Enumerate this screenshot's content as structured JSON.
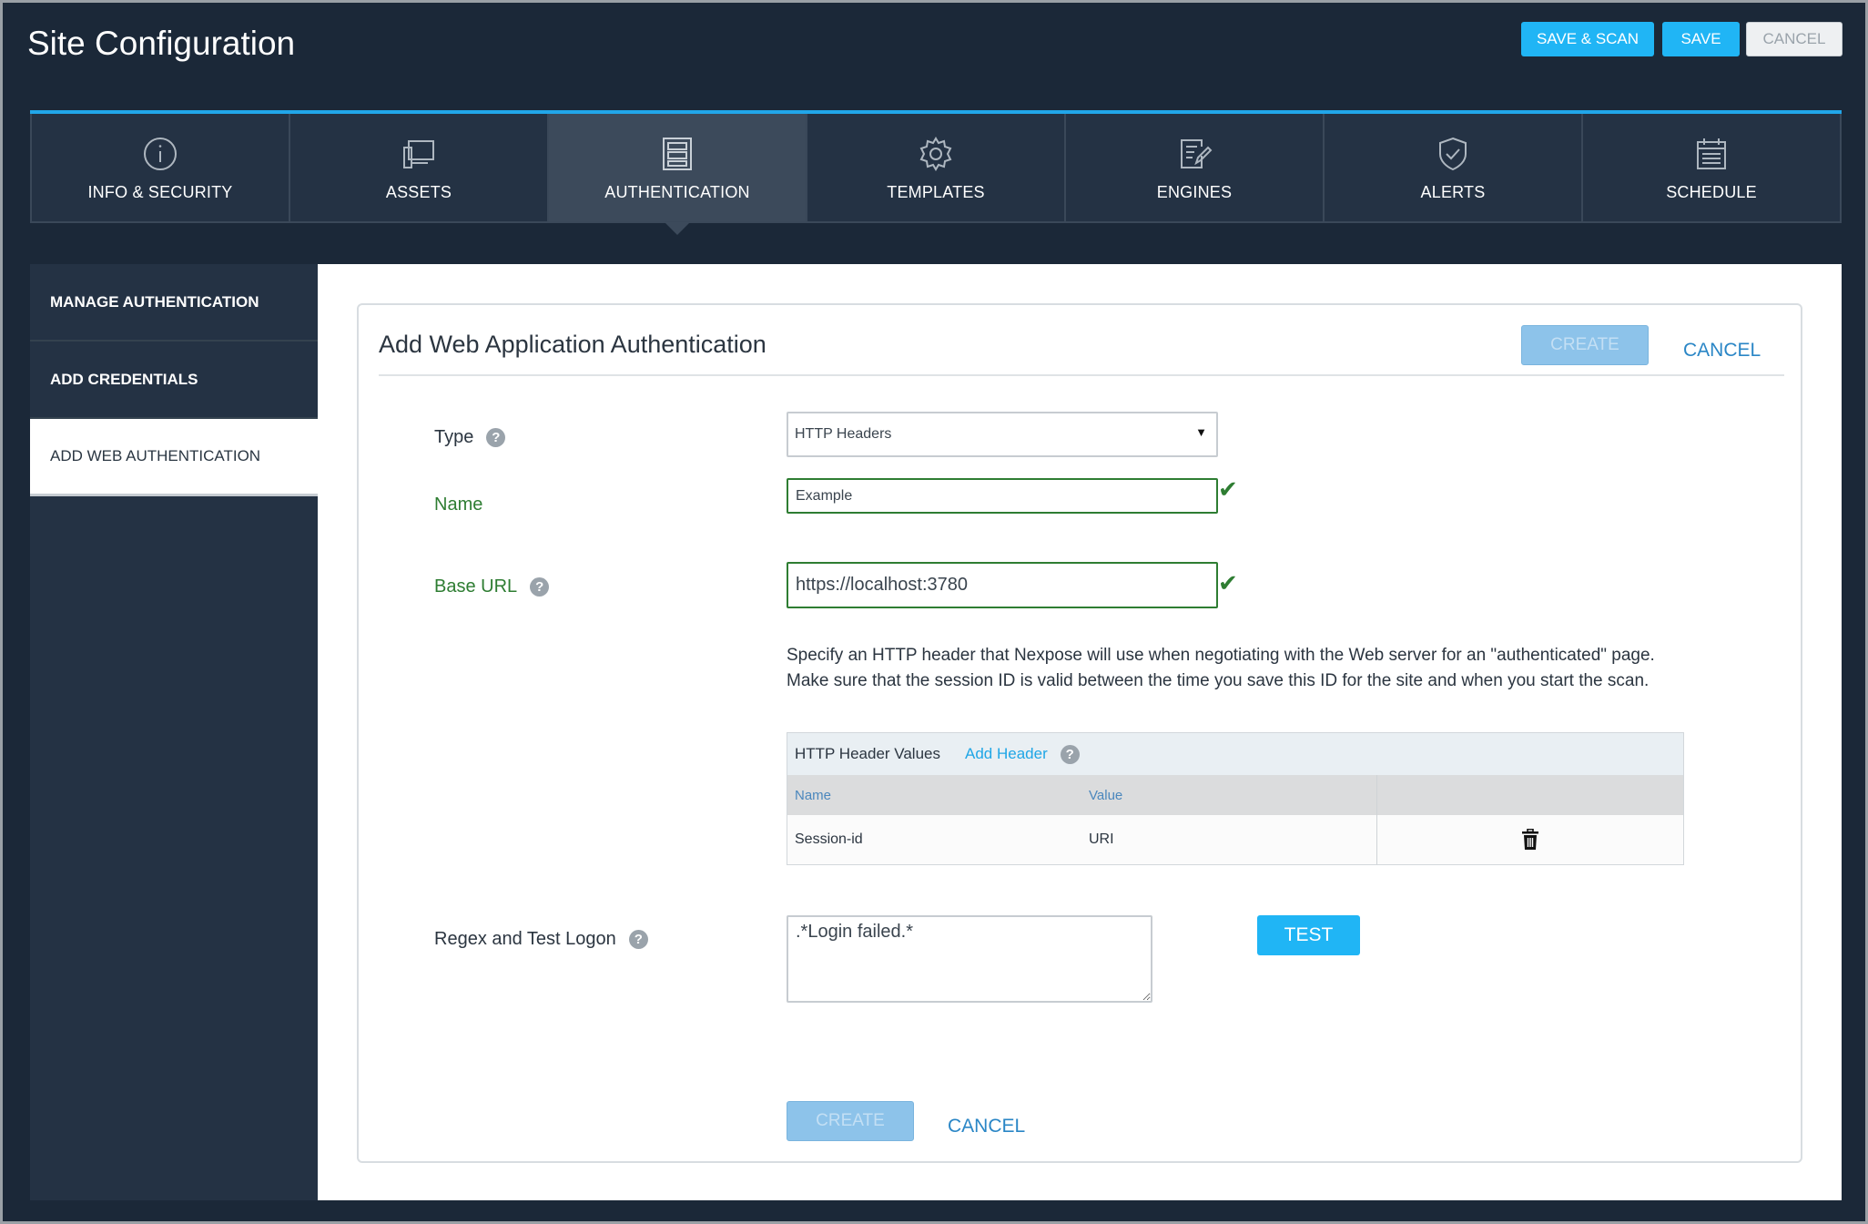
{
  "header": {
    "title": "Site Configuration",
    "save_scan_label": "SAVE & SCAN",
    "save_label": "SAVE",
    "cancel_label": "CANCEL"
  },
  "tabs": [
    {
      "label": "INFO & SECURITY",
      "icon": "info-icon"
    },
    {
      "label": "ASSETS",
      "icon": "assets-icon"
    },
    {
      "label": "AUTHENTICATION",
      "icon": "authentication-icon",
      "active": true
    },
    {
      "label": "TEMPLATES",
      "icon": "gear-icon"
    },
    {
      "label": "ENGINES",
      "icon": "engines-icon"
    },
    {
      "label": "ALERTS",
      "icon": "shield-icon"
    },
    {
      "label": "SCHEDULE",
      "icon": "calendar-icon"
    }
  ],
  "sidebar": {
    "items": [
      {
        "label": "MANAGE AUTHENTICATION"
      },
      {
        "label": "ADD CREDENTIALS"
      },
      {
        "label": "ADD WEB AUTHENTICATION",
        "active": true
      }
    ]
  },
  "form": {
    "title": "Add Web Application Authentication",
    "create_label": "CREATE",
    "cancel_label": "CANCEL",
    "type_label": "Type",
    "type_value": "HTTP Headers",
    "name_label": "Name",
    "name_value": "Example",
    "base_url_label": "Base URL",
    "base_url_value": "https://localhost:3780",
    "description": "Specify an HTTP header that Nexpose will use when negotiating with the Web server for an \"authenticated\" page. Make sure that the session ID is valid between the time you save this ID for the site and when you start the scan.",
    "header_table": {
      "title": "HTTP Header Values",
      "add_header_label": "Add Header",
      "columns": [
        "Name",
        "Value"
      ],
      "rows": [
        {
          "name": "Session-id",
          "value": "URI"
        }
      ]
    },
    "regex_label": "Regex and Test Logon",
    "regex_value": ".*Login failed.*",
    "test_label": "TEST"
  },
  "colors": {
    "accent": "#20b5f5",
    "background": "#1b2838",
    "valid": "#2e7d32"
  }
}
